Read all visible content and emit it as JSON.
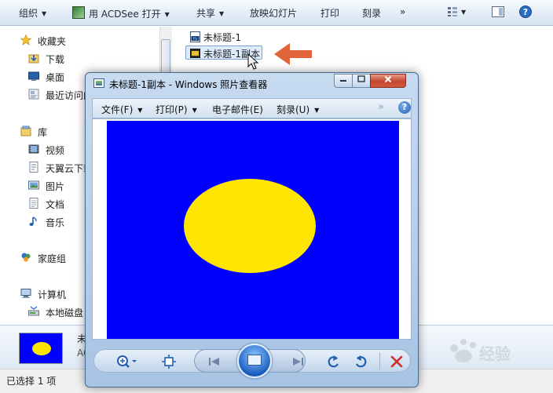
{
  "explorer": {
    "toolbar": {
      "organize": "组织",
      "open_with": "用 ACDSee 打开",
      "share": "共享",
      "slideshow": "放映幻灯片",
      "print": "打印",
      "burn": "刻录",
      "more": "»"
    },
    "nav": {
      "favorites": "收藏夹",
      "downloads": "下载",
      "desktop": "桌面",
      "recent": "最近访问的",
      "libraries": "库",
      "videos": "视频",
      "tianyi": "天翼云下载",
      "pictures": "图片",
      "documents": "文档",
      "music": "音乐",
      "homegroup": "家庭组",
      "computer": "计算机",
      "local_disk": "本地磁盘"
    },
    "files": [
      {
        "name": "未标题-1",
        "icon": "photoshop-file-icon"
      },
      {
        "name": "未标题-1副本",
        "icon": "image-file-icon"
      }
    ],
    "details": {
      "name": "未",
      "type": "AC"
    },
    "status": "已选择 1 项"
  },
  "viewer": {
    "title": "未标题-1副本 - Windows 照片查看器",
    "menu": {
      "file": "文件(F)",
      "print": "打印(P)",
      "email": "电子邮件(E)",
      "burn": "刻录(U)",
      "more": "»",
      "help": "?"
    },
    "photo_colors": {
      "background": "#0000ff",
      "shape": "#ffe600"
    }
  },
  "watermark": "Bai 经验"
}
